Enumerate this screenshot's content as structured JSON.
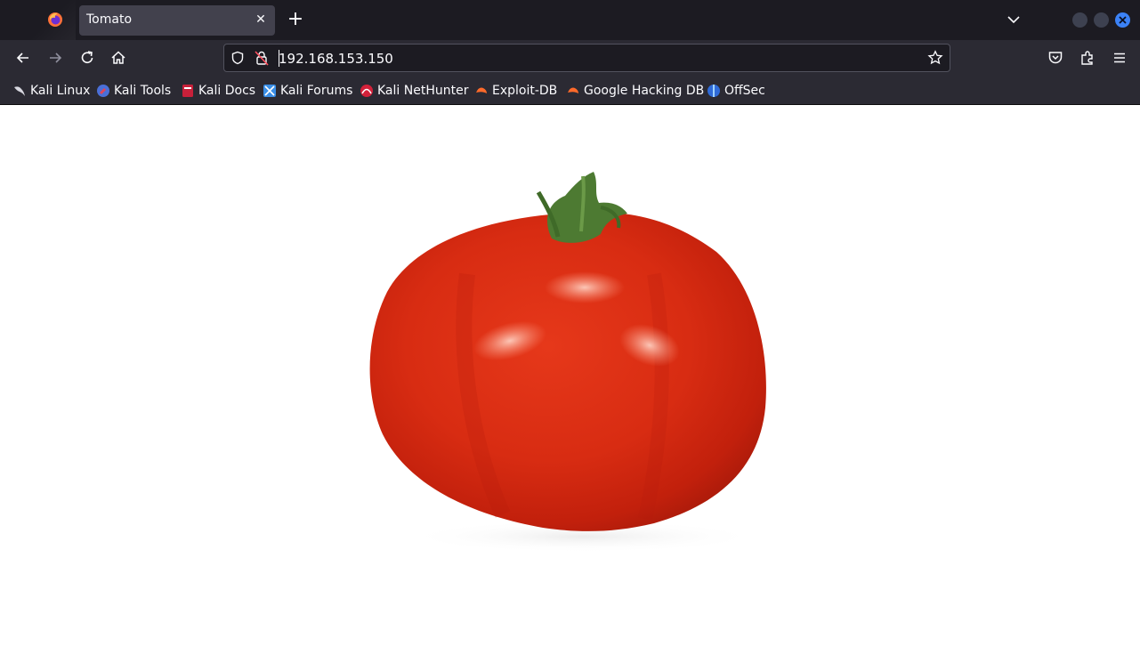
{
  "browser": {
    "tab": {
      "title": "Tomato"
    },
    "url": "192.168.153.150"
  },
  "bookmarks": [
    {
      "label": "Kali Linux",
      "icon": "kali-dragon-icon"
    },
    {
      "label": "Kali Tools",
      "icon": "kali-tools-icon"
    },
    {
      "label": "Kali Docs",
      "icon": "kali-docs-icon"
    },
    {
      "label": "Kali Forums",
      "icon": "kali-forums-icon"
    },
    {
      "label": "Kali NetHunter",
      "icon": "kali-nethunter-icon"
    },
    {
      "label": "Exploit-DB",
      "icon": "exploit-db-icon"
    },
    {
      "label": "Google Hacking DB",
      "icon": "ghdb-icon"
    },
    {
      "label": "OffSec",
      "icon": "offsec-icon"
    }
  ],
  "content": {
    "image": "tomato-image"
  },
  "colors": {
    "chrome_dark": "#1c1b22",
    "toolbar": "#2b2a33",
    "tab_active": "#42414d",
    "accent_close": "#3b82f6"
  }
}
